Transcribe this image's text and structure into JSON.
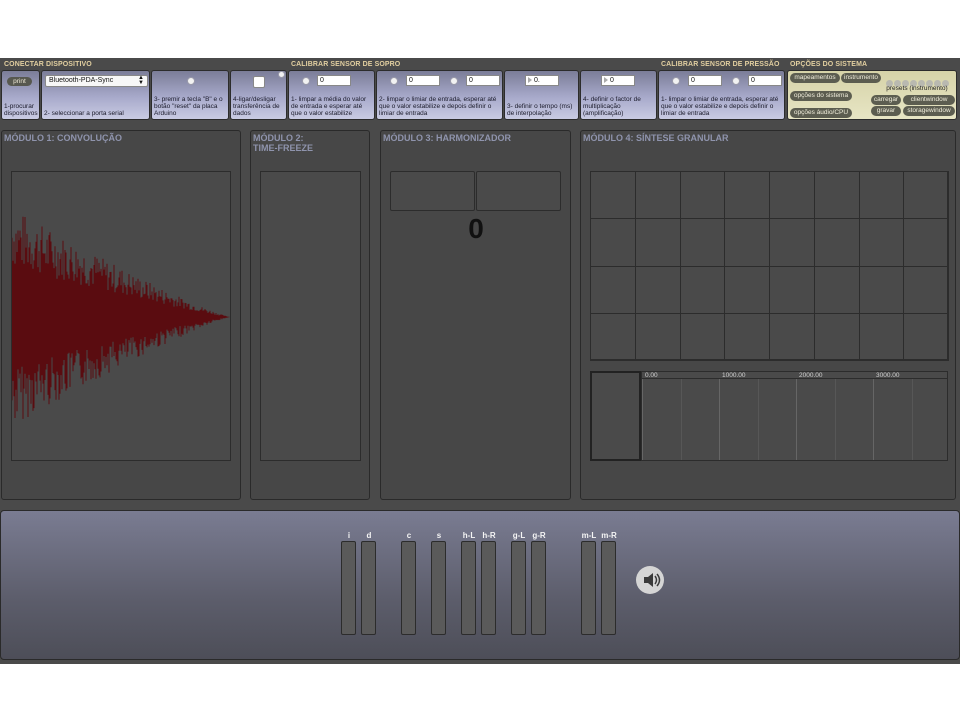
{
  "sections": {
    "connect": "CONECTAR DISPOSITIVO",
    "breath": "CALIBRAR SENSOR DE SOPRO",
    "pressure": "CALIBRAR SENSOR DE PRESSÃO",
    "system": "OPÇÕES DO SISTEMA"
  },
  "connect": {
    "print_label": "print",
    "step1": "1-procurar dispositivos",
    "device_select": "Bluetooth-PDA-Sync",
    "step2": "2- seleccionar a porta serial",
    "step3": "3- premir a tecla \"B\" e o botão \"reset\" da placa Arduino",
    "step4": "4-ligar/desligar transferência de dados"
  },
  "breath": {
    "avg_value": "0",
    "step1": "1- limpar a média do valor de entrada e esperar até que o valor estabilize",
    "thresh_a": "0",
    "thresh_b": "0",
    "step2": "2- limpar o limiar de entrada, esperar até que o valor estabilize e depois definir o limiar de entrada",
    "interp_value": "0.",
    "step3": "3- definir o tempo (ms) de interpolação",
    "mult_value": "0",
    "step4": "4- definir o factor de multiplicação (amplificação)"
  },
  "pressure": {
    "thresh_a": "0",
    "thresh_b": "0",
    "step1": "1- limpar o limiar de entrada, esperar até que o valor estabilize e depois definir o limiar de entrada"
  },
  "system": {
    "mappings": "mapeamentos",
    "instrument": "instrumento",
    "system_options": "opções do sistema",
    "audio_cpu": "opções áudio/CPU",
    "presets_label": "presets (instrumento)",
    "load": "carregar",
    "save": "gravar",
    "clientwindow": "clientwindow",
    "storagewindow": "storagewindow",
    "preset_count": 8
  },
  "modules": {
    "m1": "MÓDULO 1: CONVOLUÇÃO",
    "m2a": "MÓDULO 2:",
    "m2b": "TIME-FREEZE",
    "m3": "MÓDULO 3: HARMONIZADOR",
    "m3_value": "0",
    "m4": "MÓDULO 4: SÍNTESE GRANULAR",
    "m4_ruler": [
      "0.00",
      "1000.00",
      "2000.00",
      "3000.00"
    ]
  },
  "meters": [
    "i",
    "d",
    "c",
    "s",
    "h-L",
    "h-R",
    "g-L",
    "g-R",
    "m-L",
    "m-R"
  ],
  "icons": {
    "speaker": "speaker-icon"
  },
  "colors": {
    "waveform": "#5a0c10",
    "section_title": "#e2cfa0",
    "module_title": "#8f94ad"
  }
}
